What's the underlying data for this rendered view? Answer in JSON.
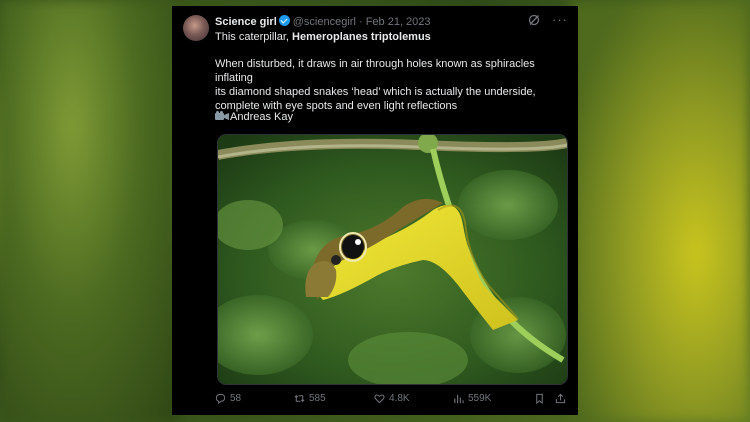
{
  "tweet": {
    "display_name": "Science girl",
    "handle": "@sciencegirl",
    "separator": "·",
    "date": "Feb 21, 2023",
    "intro_text": "This caterpillar,",
    "species": "Hemeroplanes triptolemus",
    "body": "When disturbed, it draws in air through holes known as sphiracles inflating\nits  diamond shaped snakes ‘head’ which is actually the underside,\ncomplete with eye spots and even light reflections",
    "credit": "Andreas Kay"
  },
  "actions": {
    "replies": "58",
    "reposts": "585",
    "likes": "4.8K",
    "views": "559K"
  },
  "icons": [
    "grok-icon",
    "more-icon",
    "camera-icon",
    "reply-icon",
    "repost-icon",
    "like-icon",
    "views-icon",
    "bookmark-icon",
    "share-icon"
  ],
  "colors": {
    "verified": "#1d9bf0",
    "card_bg": "#000000",
    "muted": "#71767b",
    "caterpillar": "#e6da2e"
  }
}
